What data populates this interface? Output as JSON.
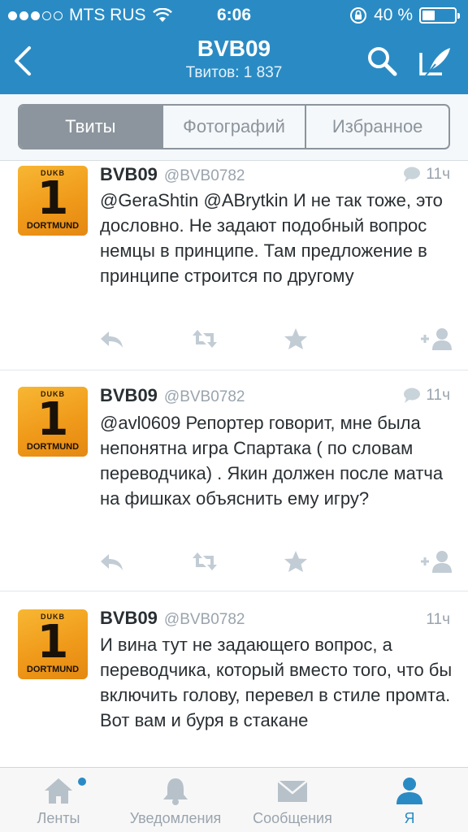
{
  "status_bar": {
    "carrier": "MTS RUS",
    "time": "6:06",
    "battery": "40 %"
  },
  "nav": {
    "title": "BVB09",
    "subtitle": "Твитов: 1 837"
  },
  "segments": [
    "Твиты",
    "Фотографий",
    "Избранное"
  ],
  "tweets": [
    {
      "name": "BVB09",
      "handle": "@BVB0782",
      "time": "11ч",
      "has_reply_icon": true,
      "text": "@GeraShtin @ABrytkin И не так тоже, это дословно. Не задают подобный вопрос немцы в принципе. Там предложение в принципе строится по другому",
      "avatar": {
        "logo": "DUKB",
        "number": "1",
        "club": "DORTMUND"
      }
    },
    {
      "name": "BVB09",
      "handle": "@BVB0782",
      "time": "11ч",
      "has_reply_icon": true,
      "text": "@avl0609 Репортер говорит, мне была непонятна игра Спартака ( по словам переводчика) . Якин должен после матча на фишках объяснить ему игру?",
      "avatar": {
        "logo": "DUKB",
        "number": "1",
        "club": "DORTMUND"
      }
    },
    {
      "name": "BVB09",
      "handle": "@BVB0782",
      "time": "11ч",
      "has_reply_icon": false,
      "text": "И вина тут не задающего вопрос, а переводчика, который вместо того, что бы включить голову, перевел в стиле промта. Вот вам и буря в стакане",
      "avatar": {
        "logo": "DUKB",
        "number": "1",
        "club": "DORTMUND"
      }
    }
  ],
  "tabbar": [
    {
      "label": "Ленты",
      "icon": "home-icon",
      "active": false
    },
    {
      "label": "Уведомления",
      "icon": "bell-icon",
      "active": false
    },
    {
      "label": "Сообщения",
      "icon": "envelope-icon",
      "active": false
    },
    {
      "label": "Я",
      "icon": "person-icon",
      "active": true
    }
  ],
  "colors": {
    "accent": "#2a8bc4",
    "muted": "#9aa4ad",
    "text": "#292f33"
  }
}
